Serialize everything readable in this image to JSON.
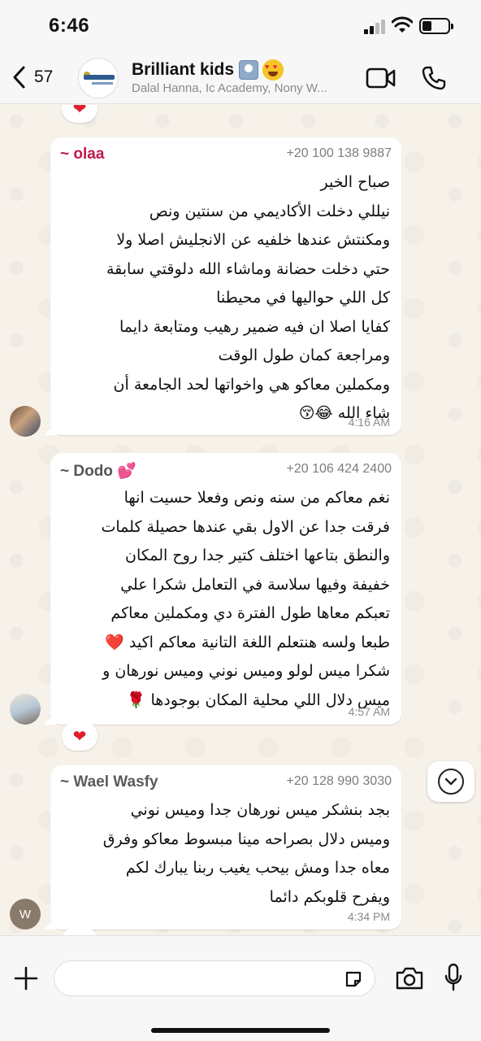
{
  "status_bar": {
    "time": "6:46"
  },
  "header": {
    "back_count": "57",
    "title": "Brilliant kids",
    "subtitle": "Dalal Hanna, Ic Academy, Nony W..."
  },
  "icons": {
    "back": "chevron-left-icon",
    "video": "video-camera-icon",
    "call": "phone-icon",
    "plus": "plus-icon",
    "sticker": "sticker-icon",
    "camera": "camera-icon",
    "mic": "microphone-icon",
    "scroll": "chevron-down-icon"
  },
  "colors": {
    "sender_olaa": "#c0184a",
    "sender_dodo": "#555555",
    "sender_wael": "#5a5a5a",
    "heart": "#e0202e"
  },
  "reactions": {
    "heart": "❤"
  },
  "messages": [
    {
      "sender": "~ olaa",
      "phone": "+20 100 138 9887",
      "lines": [
        "صباح الخير",
        "نيللي دخلت الأكاديمي من سنتين ونص",
        "ومكنتش عندها خلفيه عن الانجليش اصلا ولا",
        "حتي دخلت حضانة وماشاء الله دلوقتي سابقة",
        "كل اللي حواليها في محيطنا",
        "كفايا اصلا ان فيه ضمير رهيب ومتابعة دايما",
        "ومراجعة كمان طول الوقت",
        "ومكملين معاكو هي واخواتها لحد الجامعة أن",
        "شاء الله 😂😚"
      ],
      "time": "4:16 AM"
    },
    {
      "sender": "~ Dodo 💕",
      "phone": "+20 106 424 2400",
      "lines": [
        "نغم معاكم من سنه ونص وفعلا حسيت انها",
        "فرقت جدا عن الاول بقي عندها حصيلة كلمات",
        "والنطق بتاعها اختلف كتير جدا روح المكان",
        "خفيفة وفيها سلاسة في التعامل شكرا علي",
        "تعبكم معاها طول الفترة دي ومكملين معاكم",
        "طبعا ولسه هنتعلم اللغة التانية معاكم اكيد ❤️",
        "شكرا ميس لولو وميس نوني وميس نورهان و",
        "ميس دلال اللي محلية المكان بوجودها 🌹"
      ],
      "time": "4:57 AM"
    },
    {
      "sender": "~ Wael Wasfy",
      "phone": "+20 128 990 3030",
      "lines": [
        "بجد بنشكر ميس نورهان جدا  وميس نوني",
        "وميس دلال   بصراحه مينا مبسوط معاكو وفرق",
        "معاه جدا ومش بيحب يغيب  ربنا يبارك لكم",
        "ويفرح قلوبكم دائما"
      ],
      "time": "4:34 PM",
      "avatar_letter": "W"
    }
  ]
}
